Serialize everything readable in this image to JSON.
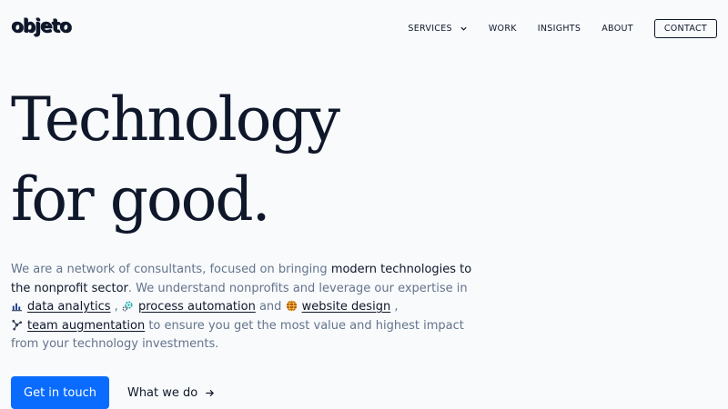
{
  "header": {
    "logo_text": "objeto",
    "nav": {
      "services": "SERVICES",
      "work": "WORK",
      "insights": "INSIGHTS",
      "about": "ABOUT",
      "contact": "CONTACT"
    }
  },
  "hero": {
    "title_line1": "Technology",
    "title_line2": "for good.",
    "desc": {
      "p1": "We are a network of consultants, focused on bringing ",
      "strong": "modern technologies to the nonprofit sector",
      "p2": ". We understand nonprofits and leverage our expertise in ",
      "link_data": "data analytics",
      "sep1": " , ",
      "link_process": "process automation",
      "sep2": " and ",
      "link_web": "website design",
      "sep3": " , ",
      "link_team": "team augmentation",
      "p3": " to ensure you get the most value and highest impact from your technology investments."
    },
    "cta_primary": "Get in touch",
    "cta_secondary": "What we do"
  },
  "colors": {
    "background": "#f8fafc",
    "text": "#0f172a",
    "muted": "#64748b",
    "accent": "#0a6cff"
  },
  "icons": {
    "services_dropdown": "chevron-down-icon",
    "data_analytics": "chart-icon",
    "process_automation": "gear-icon",
    "website_design": "globe-icon",
    "team_augmentation": "network-icon",
    "what_we_do": "arrow-right-icon"
  }
}
